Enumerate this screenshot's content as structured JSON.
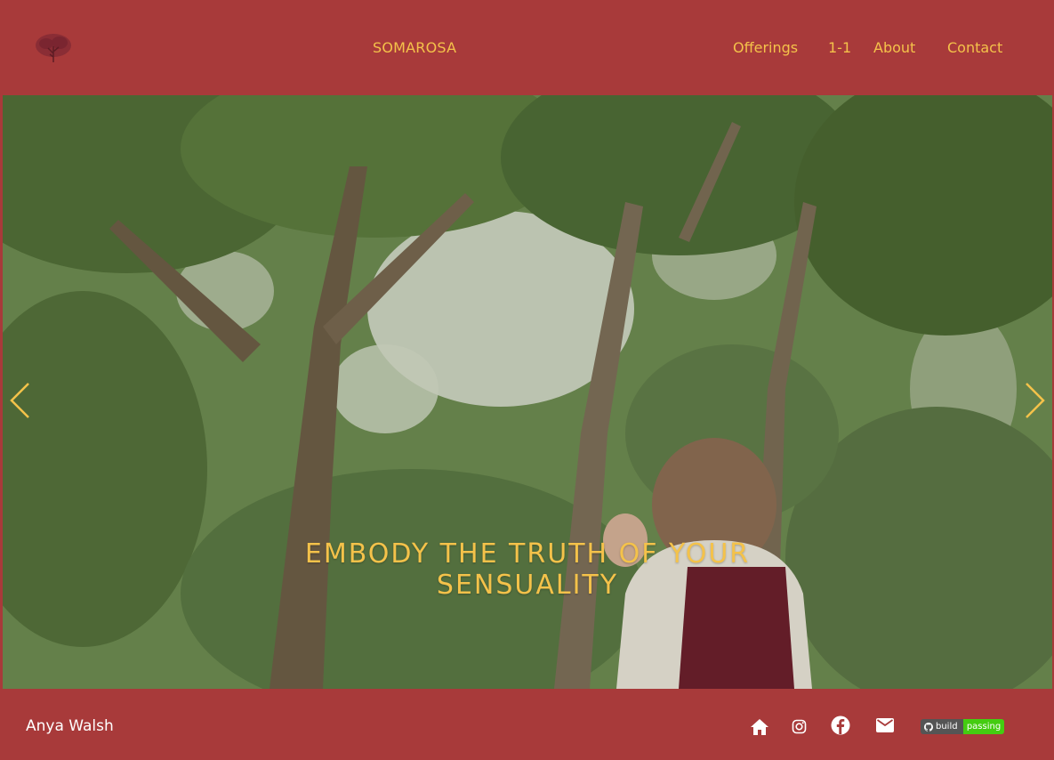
{
  "header": {
    "brand": "SOMAROSA",
    "nav": [
      "Offerings",
      "1-1",
      "About",
      "Contact"
    ],
    "logo_icon": "tree-logo-icon"
  },
  "hero": {
    "caption": "EMBODY THE TRUTH OF YOUR SENSUALITY",
    "prev_icon": "chevron-left-icon",
    "next_icon": "chevron-right-icon"
  },
  "footer": {
    "author": "Anya Walsh",
    "icons": [
      "home-icon",
      "instagram-icon",
      "facebook-icon",
      "email-icon"
    ],
    "badge": {
      "left": "build",
      "right": "passing"
    }
  },
  "colors": {
    "background": "#a83a3a",
    "accent": "#f4c24a",
    "footer_text": "#ffffff",
    "badge_pass": "#44cc11"
  }
}
